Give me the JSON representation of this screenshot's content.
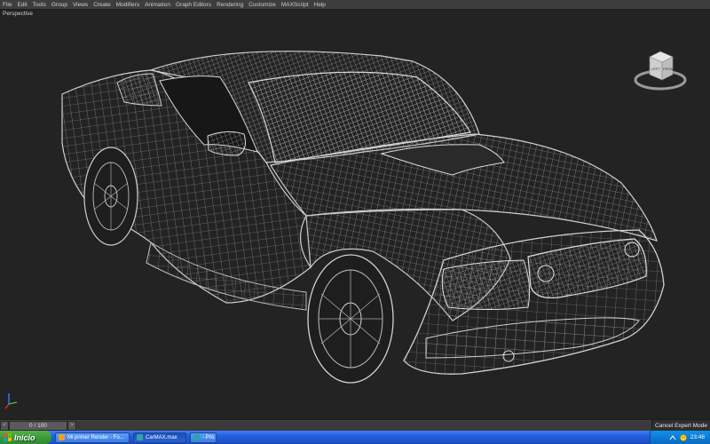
{
  "menubar": {
    "items": [
      {
        "label": "File",
        "name": "menu-file"
      },
      {
        "label": "Edit",
        "name": "menu-edit"
      },
      {
        "label": "Tools",
        "name": "menu-tools"
      },
      {
        "label": "Group",
        "name": "menu-group"
      },
      {
        "label": "Views",
        "name": "menu-views"
      },
      {
        "label": "Create",
        "name": "menu-create"
      },
      {
        "label": "Modifiers",
        "name": "menu-modifiers"
      },
      {
        "label": "Animation",
        "name": "menu-animation"
      },
      {
        "label": "Graph Editors",
        "name": "menu-graph-editors"
      },
      {
        "label": "Rendering",
        "name": "menu-rendering"
      },
      {
        "label": "Customize",
        "name": "menu-customize"
      },
      {
        "label": "MAXScript",
        "name": "menu-maxscript"
      },
      {
        "label": "Help",
        "name": "menu-help"
      }
    ]
  },
  "viewport": {
    "label": "Perspective",
    "viewcube": {
      "left_face": "LEFT",
      "front_face": "FRONT"
    },
    "colors": {
      "background": "#232323",
      "wireframe": "#c8c8c8"
    }
  },
  "timebar": {
    "frame_display": "0 / 100",
    "prev_arrow": "<",
    "next_arrow": ">",
    "expert_mode_label": "Cancel Expert Mode"
  },
  "taskbar": {
    "start_label": "Inicio",
    "tasks": [
      {
        "label": "Mi primer Render - Fo...",
        "icon": "browser-icon",
        "color": "#f0a020"
      },
      {
        "label": "CarMAX.max",
        "icon": "max-icon",
        "color": "#2aa6a6"
      },
      {
        "label": "- Pro...",
        "icon": "app-icon",
        "color": "#2aa6a6"
      }
    ],
    "clock": "23:48",
    "colors": {
      "taskbar": "#245edb",
      "start": "#3a9a3a",
      "tray": "#0c7cd6"
    }
  }
}
